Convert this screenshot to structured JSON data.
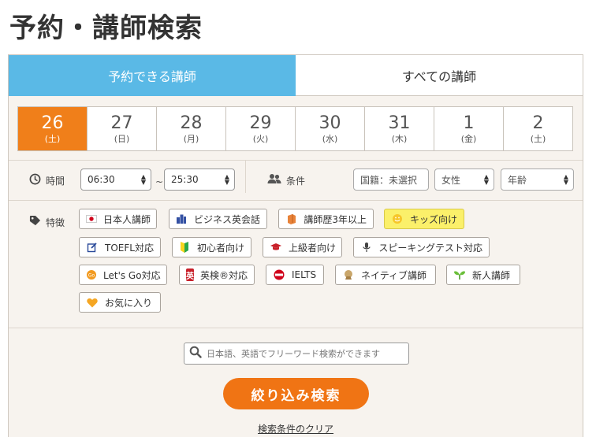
{
  "page_title": "予約・講師検索",
  "tabs": [
    {
      "label": "予約できる講師",
      "active": true
    },
    {
      "label": "すべての講師",
      "active": false
    }
  ],
  "dates": [
    {
      "num": "26",
      "dow": "(土)",
      "selected": true
    },
    {
      "num": "27",
      "dow": "(日)"
    },
    {
      "num": "28",
      "dow": "(月)"
    },
    {
      "num": "29",
      "dow": "(火)"
    },
    {
      "num": "30",
      "dow": "(水)"
    },
    {
      "num": "31",
      "dow": "(木)"
    },
    {
      "num": "1",
      "dow": "(金)"
    },
    {
      "num": "2",
      "dow": "(土)"
    }
  ],
  "time": {
    "label": "時間",
    "from": "06:30",
    "separator": "~",
    "to": "25:30"
  },
  "conditions": {
    "label": "条件",
    "nationality": "国籍：未選択",
    "gender": "女性",
    "age": "年齢"
  },
  "features": {
    "label": "特徴",
    "tags": [
      {
        "label": "日本人講師",
        "icon": "japan-flag-icon"
      },
      {
        "label": "ビジネス英会話",
        "icon": "building-icon"
      },
      {
        "label": "講師歴3年以上",
        "icon": "book-icon"
      },
      {
        "label": "キッズ向け",
        "icon": "smiley-icon",
        "highlight": true
      },
      {
        "label": "TOEFL対応",
        "icon": "edit-icon"
      },
      {
        "label": "初心者向け",
        "icon": "beginner-mark-icon"
      },
      {
        "label": "上級者向け",
        "icon": "graduation-cap-icon"
      },
      {
        "label": "スピーキングテスト対応",
        "icon": "microphone-icon"
      },
      {
        "label": "Let's Go対応",
        "icon": "letsgo-icon"
      },
      {
        "label": "英検®対応",
        "icon": "eiken-icon",
        "badge": "英"
      },
      {
        "label": "IELTS",
        "icon": "ielts-icon"
      },
      {
        "label": "ネイティブ講師",
        "icon": "native-icon"
      },
      {
        "label": "新人講師",
        "icon": "sprout-icon"
      },
      {
        "label": "お気に入り",
        "icon": "heart-icon"
      }
    ]
  },
  "search": {
    "placeholder": "日本語、英語でフリーワード検索ができます"
  },
  "submit_label": "絞り込み検索",
  "clear_label": "検索条件のクリア",
  "colors": {
    "accent_orange": "#f07414",
    "tab_blue": "#5ab9e6",
    "highlight_yellow": "#fbf06a"
  }
}
